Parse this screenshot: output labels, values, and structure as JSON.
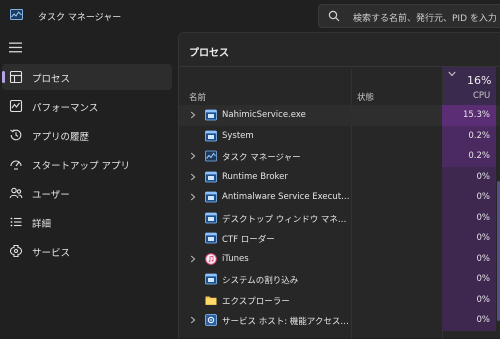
{
  "window": {
    "title": "タスク マネージャー",
    "icon": "task-manager-icon"
  },
  "search": {
    "placeholder": "検索する名前、発行元、PID を入力"
  },
  "sidebar": {
    "items": [
      {
        "label": "プロセス",
        "icon": "processes-icon",
        "active": true
      },
      {
        "label": "パフォーマンス",
        "icon": "performance-icon"
      },
      {
        "label": "アプリの履歴",
        "icon": "history-icon"
      },
      {
        "label": "スタートアップ アプリ",
        "icon": "startup-icon"
      },
      {
        "label": "ユーザー",
        "icon": "users-icon"
      },
      {
        "label": "詳細",
        "icon": "details-icon"
      },
      {
        "label": "サービス",
        "icon": "services-icon"
      }
    ]
  },
  "main": {
    "title": "プロセス",
    "columns": {
      "name": "名前",
      "status": "状態",
      "cpu_total": "16%",
      "cpu": "CPU"
    },
    "processes": [
      {
        "name": "NahimicService.exe",
        "cpu": "15.3%",
        "expandable": true,
        "icon": "app-window-icon",
        "highlight": true,
        "heat": "#5b2d74"
      },
      {
        "name": "System",
        "cpu": "0.2%",
        "expandable": false,
        "icon": "app-window-icon",
        "heat": "#4a2a60"
      },
      {
        "name": "タスク マネージャー",
        "cpu": "0.2%",
        "expandable": true,
        "icon": "task-manager-icon",
        "heat": "#4a2a60"
      },
      {
        "name": "Runtime Broker",
        "cpu": "0%",
        "expandable": true,
        "icon": "app-window-icon",
        "heat": "#3e2850"
      },
      {
        "name": "Antimalware Service Executable",
        "cpu": "0%",
        "expandable": true,
        "icon": "app-window-icon",
        "heat": "#3e2850"
      },
      {
        "name": "デスクトップ ウィンドウ マネージャー",
        "cpu": "0%",
        "expandable": false,
        "icon": "app-window-icon",
        "heat": "#3e2850"
      },
      {
        "name": "CTF ローダー",
        "cpu": "0%",
        "expandable": false,
        "icon": "app-window-icon",
        "heat": "#3e2850"
      },
      {
        "name": "iTunes",
        "cpu": "0%",
        "expandable": true,
        "icon": "itunes-icon",
        "heat": "#3e2850"
      },
      {
        "name": "システムの割り込み",
        "cpu": "0%",
        "expandable": false,
        "icon": "app-window-icon",
        "heat": "#3e2850"
      },
      {
        "name": "エクスプローラー",
        "cpu": "0%",
        "expandable": false,
        "icon": "folder-icon",
        "heat": "#3e2850"
      },
      {
        "name": "サービス ホスト: 機能アクセス マネ...",
        "cpu": "0%",
        "expandable": true,
        "icon": "service-gear-icon",
        "heat": "#3e2850"
      }
    ]
  },
  "colors": {
    "accent": "#b9a1e9",
    "cpu_header": "#3a2a4e"
  }
}
